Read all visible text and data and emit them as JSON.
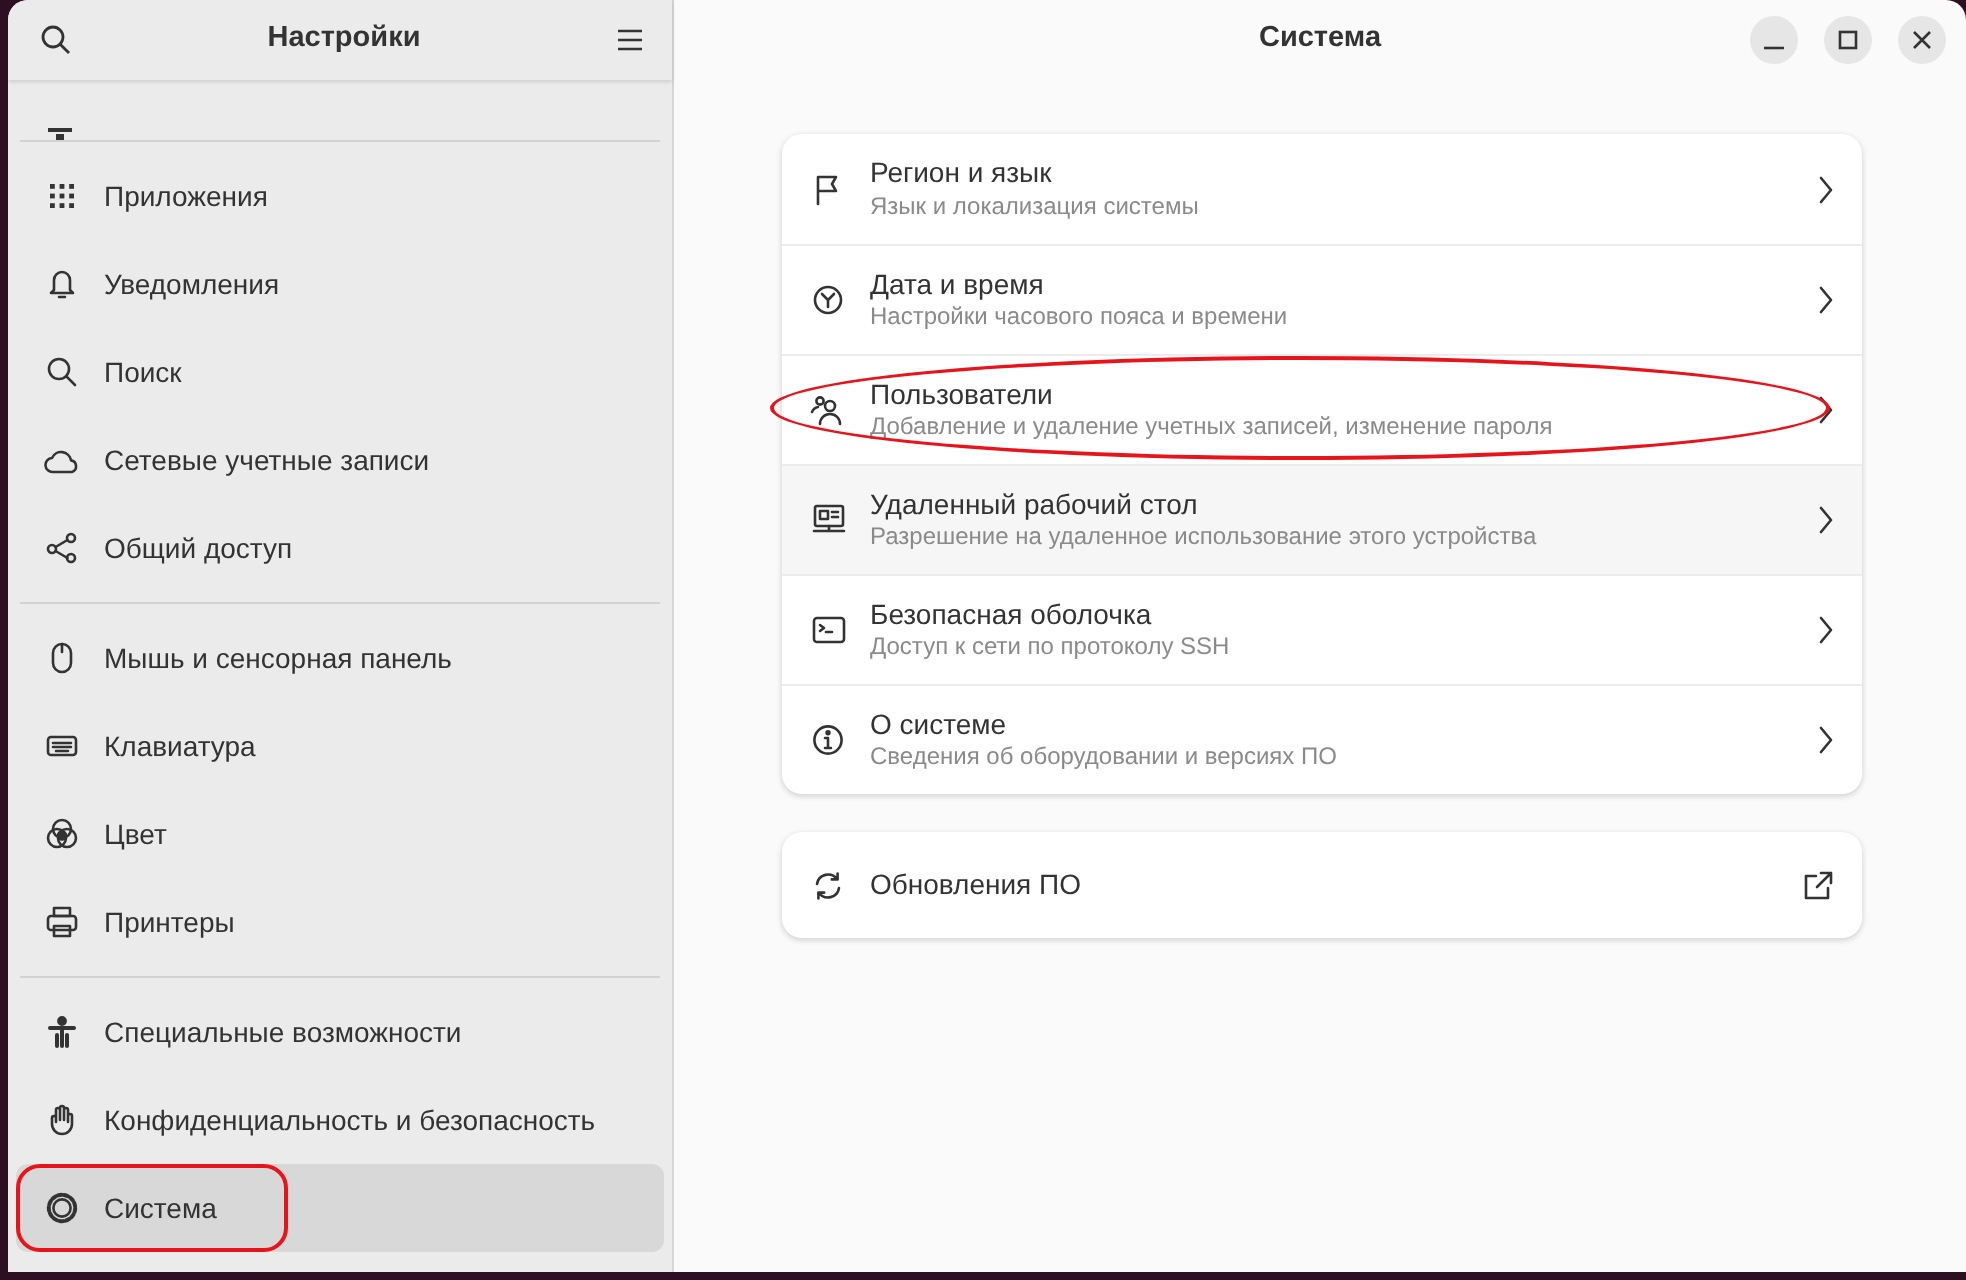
{
  "sidebar": {
    "title": "Настройки",
    "groups": [
      {
        "items": [
          {
            "label": "Приложения",
            "selected": false,
            "annotated": false
          },
          {
            "label": "Уведомления",
            "selected": false,
            "annotated": false
          },
          {
            "label": "Поиск",
            "selected": false,
            "annotated": false
          },
          {
            "label": "Сетевые учетные записи",
            "selected": false,
            "annotated": false
          },
          {
            "label": "Общий доступ",
            "selected": false,
            "annotated": false
          }
        ]
      },
      {
        "items": [
          {
            "label": "Мышь и сенсорная панель",
            "selected": false,
            "annotated": false
          },
          {
            "label": "Клавиатура",
            "selected": false,
            "annotated": false
          },
          {
            "label": "Цвет",
            "selected": false,
            "annotated": false
          },
          {
            "label": "Принтеры",
            "selected": false,
            "annotated": false
          }
        ]
      },
      {
        "items": [
          {
            "label": "Специальные возможности",
            "selected": false,
            "annotated": false
          },
          {
            "label": "Конфиденциальность и безопасность",
            "selected": false,
            "annotated": false
          },
          {
            "label": "Система",
            "selected": true,
            "annotated": true
          }
        ]
      }
    ]
  },
  "main": {
    "title": "Система",
    "rows": [
      {
        "title": "Регион и язык",
        "subtitle": "Язык и локализация системы",
        "hovered": false,
        "annotated": false
      },
      {
        "title": "Дата и время",
        "subtitle": "Настройки часового пояса и времени",
        "hovered": false,
        "annotated": false
      },
      {
        "title": "Пользователи",
        "subtitle": "Добавление и удаление учетных записей, изменение пароля",
        "hovered": false,
        "annotated": true
      },
      {
        "title": "Удаленный рабочий стол",
        "subtitle": "Разрешение на удаленное использование этого устройства",
        "hovered": true,
        "annotated": false
      },
      {
        "title": "Безопасная оболочка",
        "subtitle": "Доступ к сети по протоколу SSH",
        "hovered": false,
        "annotated": false
      },
      {
        "title": "О системе",
        "subtitle": "Сведения об оборудовании и версиях ПО",
        "hovered": false,
        "annotated": false
      }
    ],
    "link_row": {
      "title": "Обновления ПО"
    }
  }
}
